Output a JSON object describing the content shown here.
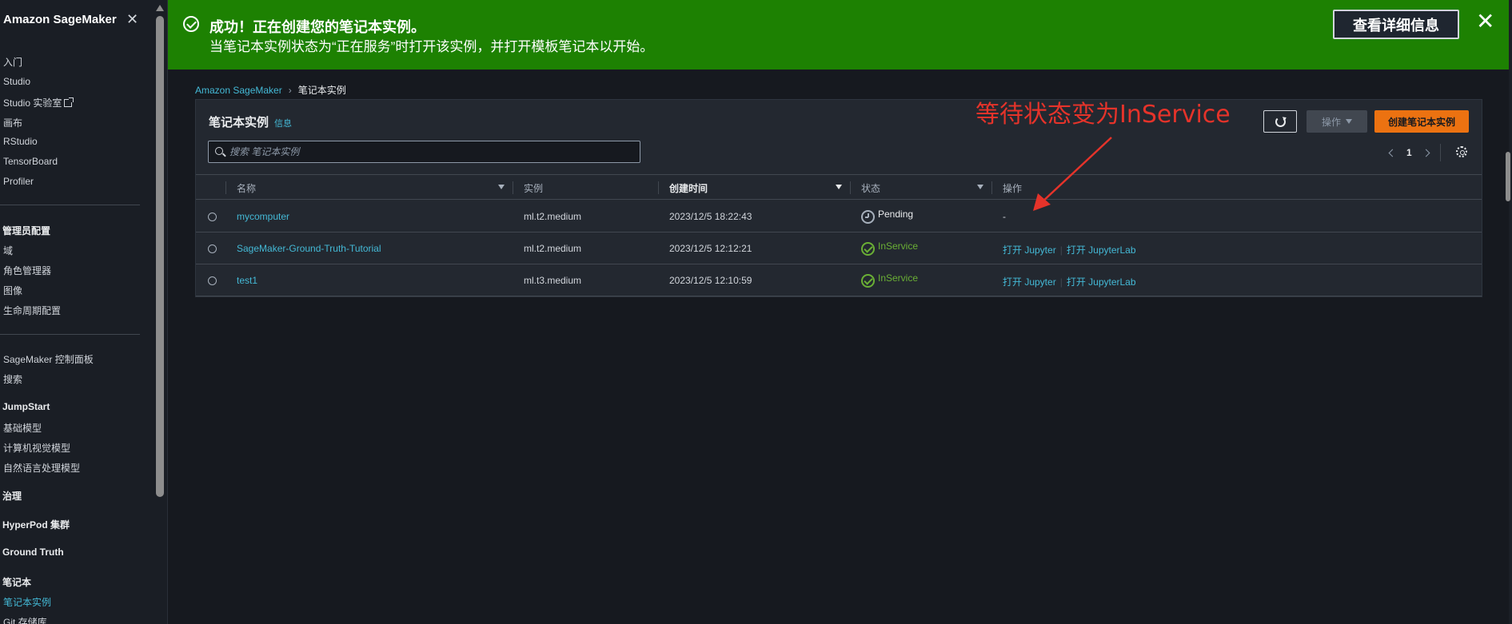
{
  "sidebar": {
    "brand": "Amazon SageMaker",
    "items": [
      {
        "label": "入门"
      },
      {
        "label": "Studio"
      },
      {
        "label": "Studio 实验室"
      },
      {
        "label": "画布"
      },
      {
        "label": "RStudio"
      },
      {
        "label": "TensorBoard"
      },
      {
        "label": "Profiler"
      }
    ],
    "admin": {
      "heading": "管理员配置",
      "items": [
        {
          "label": "域"
        },
        {
          "label": "角色管理器"
        },
        {
          "label": "图像"
        },
        {
          "label": "生命周期配置"
        }
      ]
    },
    "dashboard": {
      "label": "SageMaker 控制面板"
    },
    "search": {
      "label": "搜索"
    },
    "jumpstart": {
      "heading": "JumpStart",
      "items": [
        {
          "label": "基础模型"
        },
        {
          "label": "计算机视觉模型"
        },
        {
          "label": "自然语言处理模型"
        }
      ]
    },
    "governance": "治理",
    "hyperpod": "HyperPod 集群",
    "groundtruth": "Ground Truth",
    "notebook": {
      "heading": "笔记本",
      "items": [
        {
          "label": "笔记本实例",
          "active": true
        },
        {
          "label": "Git 存储库"
        }
      ]
    }
  },
  "flash": {
    "title": "成功！正在创建您的笔记本实例。",
    "description": "当笔记本实例状态为“正在服务”时打开该实例，并打开模板笔记本以开始。",
    "detail_button": "查看详细信息",
    "color": "#1d8102"
  },
  "breadcrumb": {
    "root": "Amazon SageMaker",
    "current": "笔记本实例"
  },
  "panel": {
    "title": "笔记本实例",
    "info": "信息",
    "search_placeholder": "搜索 笔记本实例",
    "buttons": {
      "actions": "操作",
      "create": "创建笔记本实例"
    },
    "page": "1"
  },
  "table": {
    "columns": [
      "名称",
      "实例",
      "创建时间",
      "状态",
      "操作"
    ],
    "rows": [
      {
        "name": "mycomputer",
        "instance": "ml.t2.medium",
        "created": "2023/12/5 18:22:43",
        "status": "Pending",
        "actions": "-"
      },
      {
        "name": "SageMaker-Ground-Truth-Tutorial",
        "instance": "ml.t2.medium",
        "created": "2023/12/5 12:12:21",
        "status": "InService",
        "open_jupyter": "打开 Jupyter",
        "open_lab": "打开 JupyterLab"
      },
      {
        "name": "test1",
        "instance": "ml.t3.medium",
        "created": "2023/12/5 12:10:59",
        "status": "InService",
        "open_jupyter": "打开 Jupyter",
        "open_lab": "打开 JupyterLab"
      }
    ]
  },
  "annotation": {
    "text": "等待状态变为InService",
    "color": "#e5332a"
  },
  "colors": {
    "accent_link": "#44b9d6",
    "primary_button": "#ec7211",
    "success": "#6aaf35"
  }
}
